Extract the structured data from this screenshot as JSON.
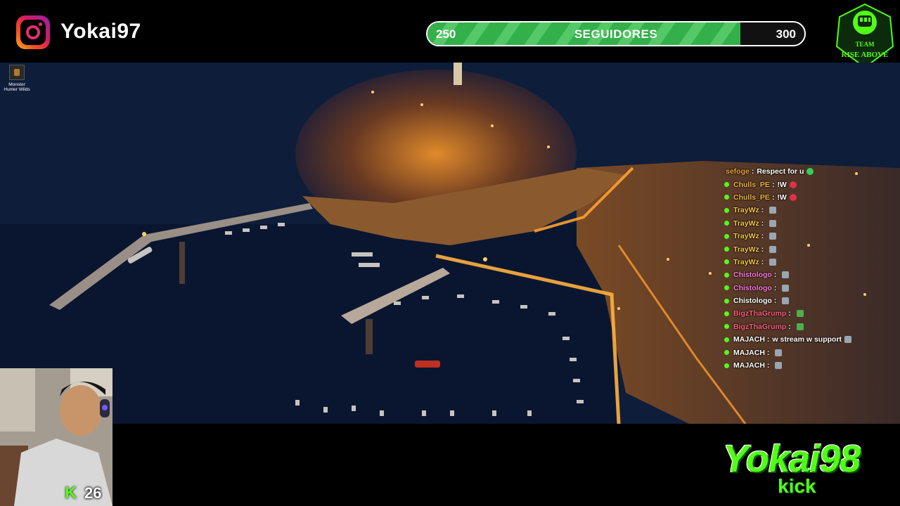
{
  "overlay": {
    "instagram_icon": "instagram-icon",
    "handle": "Yokai97",
    "follower_goal": {
      "start": "250",
      "title": "SEGUIDORES",
      "end": "300",
      "progress": 0.83
    },
    "team_logo_text": [
      "TEAM",
      "RISE ABOVE"
    ]
  },
  "desktop": {
    "icon_label": "Monster Hunter Wilds"
  },
  "chat": [
    {
      "user": "sefoge",
      "color": "#e8a53a",
      "badge": false,
      "message": "Respect for u",
      "emote": "green-heart"
    },
    {
      "user": "Chulls_PE",
      "color": "#f0b43c",
      "badge": true,
      "message": "!W",
      "emote": "red-heart"
    },
    {
      "user": "Chulls_PE",
      "color": "#f0b43c",
      "badge": true,
      "message": "!W",
      "emote": "red-heart"
    },
    {
      "user": "TrayWz",
      "color": "#f5c842",
      "badge": true,
      "message": "",
      "emote": "emote"
    },
    {
      "user": "TrayWz",
      "color": "#f5c842",
      "badge": true,
      "message": "",
      "emote": "emote"
    },
    {
      "user": "TrayWz",
      "color": "#f5c842",
      "badge": true,
      "message": "",
      "emote": "emote"
    },
    {
      "user": "TrayWz",
      "color": "#f5c842",
      "badge": true,
      "message": "",
      "emote": "emote"
    },
    {
      "user": "TrayWz",
      "color": "#f5c842",
      "badge": true,
      "message": "",
      "emote": "emote"
    },
    {
      "user": "Chistologo",
      "color": "#ff7ad9",
      "badge": true,
      "message": "",
      "emote": "emote"
    },
    {
      "user": "Chistologo",
      "color": "#ff7ad9",
      "badge": true,
      "message": "",
      "emote": "emote"
    },
    {
      "user": "Chistologo",
      "color": "#ffffff",
      "badge": true,
      "message": "",
      "emote": "emote"
    },
    {
      "user": "BigzThaGrump",
      "color": "#ff5e7e",
      "badge": true,
      "message": "",
      "emote": "leaf"
    },
    {
      "user": "BigzThaGrump",
      "color": "#ff5e7e",
      "badge": true,
      "message": "",
      "emote": "leaf"
    },
    {
      "user": "MAJACH",
      "color": "#ffffff",
      "badge": true,
      "message": "w stream w support",
      "emote": "emote"
    },
    {
      "user": "MAJACH",
      "color": "#ffffff",
      "badge": true,
      "message": "",
      "emote": "emote"
    },
    {
      "user": "MAJACH",
      "color": "#ffffff",
      "badge": true,
      "message": "",
      "emote": "emote"
    }
  ],
  "webcam": {
    "kick_badge": "K",
    "viewer_count": "26"
  },
  "branding": {
    "name": "Yokai98",
    "platform": "kick"
  },
  "colors": {
    "kick_green": "#53fc18",
    "goal_fill": "#34b04a"
  }
}
